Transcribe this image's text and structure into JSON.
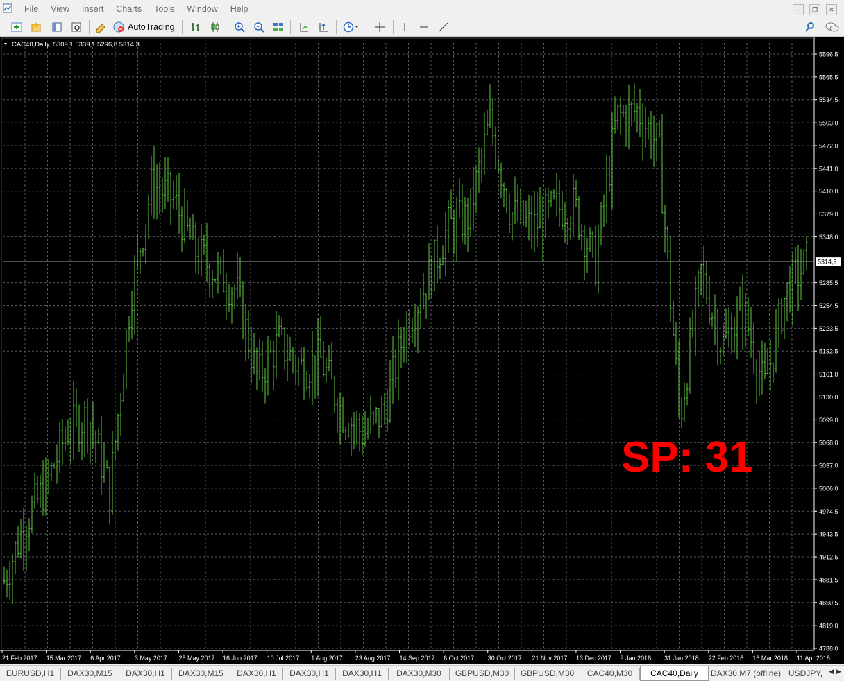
{
  "menu": [
    "File",
    "View",
    "Insert",
    "Charts",
    "Tools",
    "Window",
    "Help"
  ],
  "toolbar": {
    "autotrading_label": "AutoTrading"
  },
  "chart": {
    "header": "CAC40,Daily  5309,1 5339,1 5296,8 5314,3",
    "watermark": "SP: 31",
    "current_price": "5314,3",
    "y_ticks": [
      "5596,5",
      "5565,5",
      "5534,5",
      "5503,0",
      "5472,0",
      "5441,0",
      "5410,0",
      "5379,0",
      "5348,0",
      "5285,5",
      "5254,5",
      "5223,5",
      "5192,5",
      "5161,0",
      "5130,0",
      "5099,0",
      "5068,0",
      "5037,0",
      "5006,0",
      "4974,5",
      "4943,5",
      "4912,5",
      "4881,5",
      "4850,5",
      "4819,0",
      "4788,0"
    ],
    "x_ticks": [
      "21 Feb 2017",
      "15 Mar 2017",
      "6 Apr 2017",
      "3 May 2017",
      "25 May 2017",
      "16 Jun 2017",
      "10 Jul 2017",
      "1 Aug 2017",
      "23 Aug 2017",
      "14 Sep 2017",
      "6 Oct 2017",
      "30 Oct 2017",
      "21 Nov 2017",
      "13 Dec 2017",
      "9 Jan 2018",
      "31 Jan 2018",
      "22 Feb 2018",
      "16 Mar 2018",
      "11 Apr 2018"
    ],
    "colors": {
      "background": "#000000",
      "bars": "#5fc842",
      "grid": "#5a5a5a",
      "watermark": "#ff0000",
      "axis_text": "#ffffff"
    }
  },
  "chart_data": {
    "type": "ohlc",
    "symbol": "CAC40",
    "timeframe": "Daily",
    "ylim": [
      4788.0,
      5596.5
    ],
    "last": {
      "open": 5309.1,
      "high": 5339.1,
      "low": 5296.8,
      "close": 5314.3
    },
    "series": [
      {
        "date": "21 Feb 2017",
        "close": 4880
      },
      {
        "date": "1 Mar 2017",
        "close": 4960
      },
      {
        "date": "15 Mar 2017",
        "close": 5010
      },
      {
        "date": "24 Mar 2017",
        "close": 5085
      },
      {
        "date": "6 Apr 2017",
        "close": 5105
      },
      {
        "date": "13 Apr 2017",
        "close": 5000
      },
      {
        "date": "24 Apr 2017",
        "close": 5270
      },
      {
        "date": "3 May 2017",
        "close": 5420
      },
      {
        "date": "12 May 2017",
        "close": 5400
      },
      {
        "date": "25 May 2017",
        "close": 5330
      },
      {
        "date": "6 Jun 2017",
        "close": 5300
      },
      {
        "date": "16 Jun 2017",
        "close": 5275
      },
      {
        "date": "28 Jun 2017",
        "close": 5155
      },
      {
        "date": "10 Jul 2017",
        "close": 5205
      },
      {
        "date": "20 Jul 2017",
        "close": 5170
      },
      {
        "date": "1 Aug 2017",
        "close": 5180
      },
      {
        "date": "11 Aug 2017",
        "close": 5110
      },
      {
        "date": "23 Aug 2017",
        "close": 5080
      },
      {
        "date": "1 Sep 2017",
        "close": 5110
      },
      {
        "date": "14 Sep 2017",
        "close": 5225
      },
      {
        "date": "25 Sep 2017",
        "close": 5285
      },
      {
        "date": "6 Oct 2017",
        "close": 5360
      },
      {
        "date": "17 Oct 2017",
        "close": 5375
      },
      {
        "date": "30 Oct 2017",
        "close": 5505
      },
      {
        "date": "10 Nov 2017",
        "close": 5380
      },
      {
        "date": "21 Nov 2017",
        "close": 5360
      },
      {
        "date": "1 Dec 2017",
        "close": 5385
      },
      {
        "date": "13 Dec 2017",
        "close": 5390
      },
      {
        "date": "27 Dec 2017",
        "close": 5310
      },
      {
        "date": "9 Jan 2018",
        "close": 5510
      },
      {
        "date": "19 Jan 2018",
        "close": 5520
      },
      {
        "date": "31 Jan 2018",
        "close": 5470
      },
      {
        "date": "9 Feb 2018",
        "close": 5100
      },
      {
        "date": "22 Feb 2018",
        "close": 5300
      },
      {
        "date": "5 Mar 2018",
        "close": 5200
      },
      {
        "date": "16 Mar 2018",
        "close": 5250
      },
      {
        "date": "26 Mar 2018",
        "close": 5140
      },
      {
        "date": "4 Apr 2018",
        "close": 5270
      },
      {
        "date": "11 Apr 2018",
        "close": 5314.3
      }
    ]
  },
  "tabs": [
    "EURUSD,H1",
    "DAX30,M15",
    "DAX30,H1",
    "DAX30,M15",
    "DAX30,H1",
    "DAX30,H1",
    "DAX30,H1",
    "DAX30,M30",
    "GBPUSD,M30",
    "GBPUSD,M30",
    "CAC40,M30",
    "CAC40,Daily",
    "DAX30,M7 (offline)",
    "USDJPY,"
  ],
  "active_tab": "CAC40,Daily"
}
